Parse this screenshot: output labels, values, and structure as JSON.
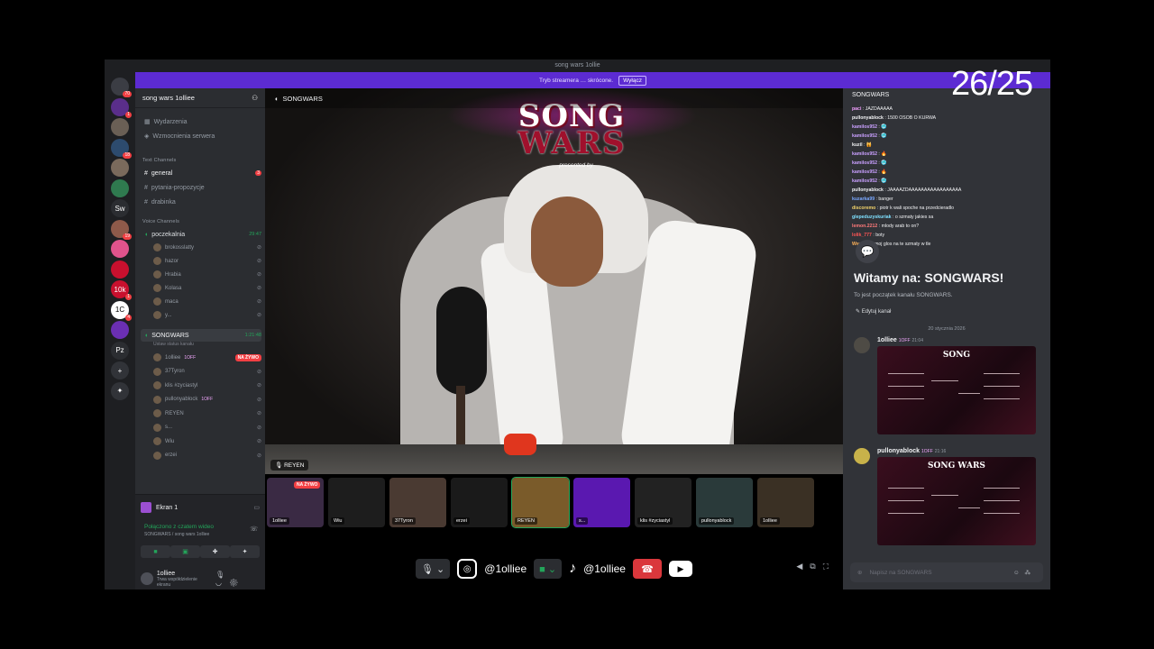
{
  "window": {
    "title": "song wars 1ollie"
  },
  "banner": {
    "text": "Tryb streamera … skrócone.",
    "button": "Wyłącz"
  },
  "servers": [
    {
      "label": "",
      "badge": "70",
      "color": "#3b3d44"
    },
    {
      "label": "",
      "badge": "1",
      "color": "#5a2e8a"
    },
    {
      "label": "",
      "badge": "",
      "color": "#6a5f55"
    },
    {
      "label": "",
      "badge": "18",
      "color": "#2d4b6e"
    },
    {
      "label": "",
      "badge": "",
      "color": "#7a6a5c"
    },
    {
      "label": "",
      "badge": "",
      "color": "#2f7a4f"
    },
    {
      "label": "Sw",
      "badge": "",
      "color": "#2b2d31"
    },
    {
      "label": "",
      "badge": "19",
      "color": "#8e5a4a"
    },
    {
      "label": "",
      "badge": "",
      "color": "#e0538c"
    },
    {
      "label": "",
      "badge": "",
      "color": "#c8102e"
    },
    {
      "label": "10k",
      "badge": "1",
      "color": "#c8102e"
    },
    {
      "label": "1C",
      "badge": "4",
      "color": "#ffffff"
    },
    {
      "label": "",
      "badge": "",
      "color": "#6b2fb3"
    },
    {
      "label": "Pz",
      "badge": "",
      "color": "#2b2d31"
    },
    {
      "label": "+",
      "badge": "",
      "color": "#313338"
    },
    {
      "label": "✦",
      "badge": "",
      "color": "#313338"
    }
  ],
  "sidebar": {
    "guild_name": "song wars 1olliee",
    "top_items": [
      "Wydarzenia",
      "Wzmocnienia serwera"
    ],
    "text_category": "Text Channels",
    "text_channels": [
      {
        "name": "general",
        "badge": "3"
      },
      {
        "name": "pytania-propozycje",
        "badge": ""
      },
      {
        "name": "drabinka",
        "badge": ""
      }
    ],
    "voice_category": "Voice Channels",
    "waiting_room": {
      "name": "poczekalnia",
      "time": "29:47"
    },
    "waiting_users": [
      "brokosslatty",
      "hazor",
      "Hrabia",
      "Kolasa",
      "maca",
      "y..."
    ],
    "songwars_channel": {
      "name": "SONGWARS",
      "time": "1:21:48",
      "status": "Ustaw status kanału"
    },
    "songwars_users": [
      {
        "name": "1olliee",
        "badge": "1OFF",
        "live": "NA ŻYWO"
      },
      {
        "name": "37Tyron",
        "badge": "",
        "live": ""
      },
      {
        "name": "klis #zyciastyl",
        "badge": "",
        "live": ""
      },
      {
        "name": "pullonyablock",
        "badge": "1OFF",
        "live": ""
      },
      {
        "name": "REYEN",
        "badge": "",
        "live": ""
      },
      {
        "name": "s...",
        "badge": "",
        "live": ""
      },
      {
        "name": "Wiu",
        "badge": "",
        "live": ""
      },
      {
        "name": "erzei",
        "badge": "",
        "live": ""
      }
    ]
  },
  "voice_panel": {
    "screen_label": "Ekran 1",
    "connected": "Połączono z czatem wideo",
    "connected_sub": "SONGWARS / song wars 1olliee",
    "user_name": "1olliee",
    "user_status": "Trwa współdzielenie ekranu"
  },
  "stage": {
    "channel": "SONGWARS",
    "overlay_title_1": "SONG",
    "overlay_title_2": "WARS",
    "overlay_sub": "presented by",
    "speaker_tag": "REYEN",
    "tiles": [
      {
        "name": "1olliee",
        "live": "NA ŻYWO",
        "color": "#3a2a44"
      },
      {
        "name": "Wiu",
        "live": "",
        "color": "#1d1d1d"
      },
      {
        "name": "37Tyron",
        "live": "",
        "color": "#4a3a32"
      },
      {
        "name": "erzei",
        "live": "",
        "color": "#1a1a1a"
      },
      {
        "name": "REYEN",
        "live": "",
        "color": "#7a5b2a"
      },
      {
        "name": "s...",
        "live": "",
        "color": "#5a18b0"
      },
      {
        "name": "klis #zyciastyl",
        "live": "",
        "color": "#222"
      },
      {
        "name": "pullonyablock",
        "live": "",
        "color": "#2a3a3a"
      },
      {
        "name": "1olliee",
        "live": "",
        "color": "#3a3024"
      }
    ],
    "instagram_handle": "@1olliee",
    "tiktok_handle": "@1olliee"
  },
  "chat": {
    "channel": "SONGWARS",
    "counter": "26/25",
    "lines": [
      {
        "name": "paci",
        "text": "JAZDAAAAA",
        "color": "#f2a0ff"
      },
      {
        "name": "pullonyablock",
        "text": "1500 OSOB O KURWA",
        "color": "#f2f3f5"
      },
      {
        "name": "kamilos952",
        "text": "🥶",
        "color": "#c9a0ff"
      },
      {
        "name": "kamilos952",
        "text": "🥶",
        "color": "#c9a0ff"
      },
      {
        "name": "kuzil",
        "text": "🙀",
        "color": "#f2f3f5"
      },
      {
        "name": "kamilos952",
        "text": "🔥",
        "color": "#c9a0ff"
      },
      {
        "name": "kamilos952",
        "text": "🥶",
        "color": "#c9a0ff"
      },
      {
        "name": "kamilos952",
        "text": "🔥",
        "color": "#c9a0ff"
      },
      {
        "name": "kamilos952",
        "text": "🥶",
        "color": "#c9a0ff"
      },
      {
        "name": "pullonyablock",
        "text": "JAAAAZDAAAAAAAAAAAAAAAAA",
        "color": "#f2f3f5"
      },
      {
        "name": "kuzarka99",
        "text": "banger",
        "color": "#7aa8ff"
      },
      {
        "name": "discoremo",
        "text": "piotr k wali spoche na przedcieradlo",
        "color": "#f2d36a"
      },
      {
        "name": "glepeduzyskuriak",
        "text": "o szmaty jakies sa",
        "color": "#7fe0ff"
      },
      {
        "name": "lemon.2212",
        "text": "mlody arab to on?",
        "color": "#ff7a7a"
      },
      {
        "name": "lolik_777",
        "text": "boty",
        "color": "#ff5555"
      },
      {
        "name": "Wwo_01",
        "text": "moj glos na te szmaty w tle",
        "color": "#ffb35a"
      }
    ],
    "welcome_title": "Witamy na: SONGWARS!",
    "welcome_sub": "To jest początek kanału SONGWARS.",
    "edit_channel": "Edytuj kanał",
    "date_divider": "20 stycznia 2026",
    "messages": [
      {
        "author": "1olliee",
        "badge": "1OFF",
        "time": "21:04",
        "image_title": "SONG"
      },
      {
        "author": "pullonyablock",
        "badge": "1OFF",
        "time": "21:16",
        "image_title": "SONG WARS"
      }
    ],
    "composer_placeholder": "Napisz na SONGWARS"
  }
}
